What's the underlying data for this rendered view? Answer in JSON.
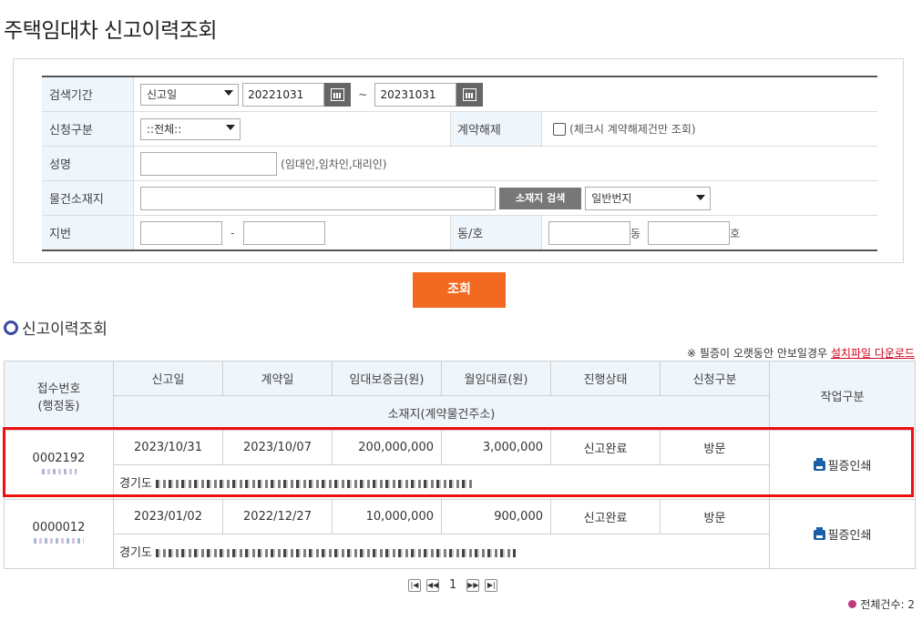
{
  "page_title": "주택임대차 신고이력조회",
  "search": {
    "period_label": "검색기간",
    "period_type": "신고일",
    "date_from": "20221031",
    "date_sep": "~",
    "date_to": "20231031",
    "apply_type_label": "신청구분",
    "apply_type_value": "::전체::",
    "cancel_label": "계약해제",
    "cancel_hint": "(체크시 계약해제건만 조회)",
    "name_label": "성명",
    "name_hint": "(임대인,임차인,대리인)",
    "location_label": "물건소재지",
    "address_search_button": "소재지 검색",
    "lot_type": "일반번지",
    "jibun_label": "지번",
    "jibun_sep": "-",
    "dongho_label": "동/호",
    "dong_suffix": "동",
    "ho_suffix": "호"
  },
  "search_button": "조회",
  "section_title": "신고이력조회",
  "notice_text": "※ 필증이 오랫동안 안보일경우",
  "notice_link": "설치파일 다운로드",
  "table": {
    "headers": {
      "receipt_no": "접수번호",
      "receipt_no_sub": "(행정동)",
      "report_date": "신고일",
      "contract_date": "계약일",
      "deposit": "임대보증금(원)",
      "monthly_rent": "월임대료(원)",
      "status": "진행상태",
      "apply_type": "신청구분",
      "address": "소재지(계약물건주소)",
      "action": "작업구분"
    },
    "rows": [
      {
        "receipt_no": "0002192",
        "report_date": "2023/10/31",
        "contract_date": "2023/10/07",
        "deposit": "200,000,000",
        "monthly_rent": "3,000,000",
        "status": "신고완료",
        "apply_type": "방문",
        "address_prefix": "경기도",
        "action": "필증인쇄"
      },
      {
        "receipt_no": "0000012",
        "report_date": "2023/01/02",
        "contract_date": "2022/12/27",
        "deposit": "10,000,000",
        "monthly_rent": "900,000",
        "status": "신고완료",
        "apply_type": "방문",
        "address_prefix": "경기도",
        "action": "필증인쇄"
      }
    ]
  },
  "pager": {
    "current_page": "1"
  },
  "total_label": "전체건수: 2",
  "icons": {
    "calendar": "calendar-icon",
    "printer": "printer-icon",
    "section_bullet": "ring-bullet-icon"
  },
  "colors": {
    "search_button": "#f26a21",
    "highlight": "#ee1111",
    "label_bg": "#eef5fb",
    "section_bullet": "#3b4a9e"
  }
}
